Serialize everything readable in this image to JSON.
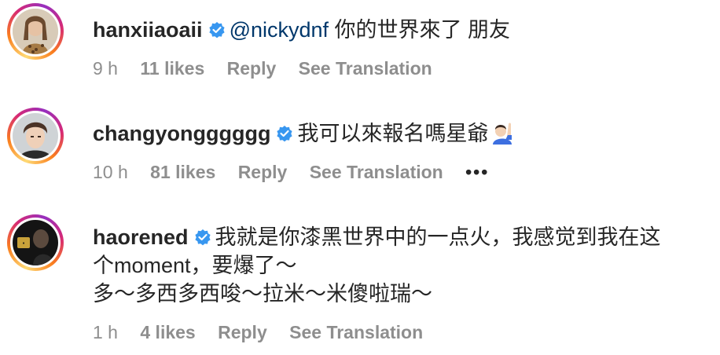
{
  "comments": [
    {
      "username": "hanxiiaoaii",
      "mention": "@nickydnf",
      "text": " 你的世界來了 朋友",
      "time": "9 h",
      "likes": "11 likes",
      "reply": "Reply",
      "translate": "See Translation"
    },
    {
      "username": "changyongggggg",
      "text": "我可以來報名嗎星爺",
      "emoji": "raising-hand-emoji",
      "time": "10 h",
      "likes": "81 likes",
      "reply": "Reply",
      "translate": "See Translation",
      "more": "•••"
    },
    {
      "username": "haorened",
      "text_line1": "我就是你漆黑世界中的一点火，我感觉到我在这",
      "text_line2": "个moment，要爆了～",
      "text_line3": "多～多西多西唆～拉米～米傻啦瑞～",
      "time": "1 h",
      "likes": "4 likes",
      "reply": "Reply",
      "translate": "See Translation"
    }
  ],
  "colors": {
    "text": "#262626",
    "meta": "#8e8e8e",
    "mention": "#00376b",
    "verified": "#3897f0"
  }
}
